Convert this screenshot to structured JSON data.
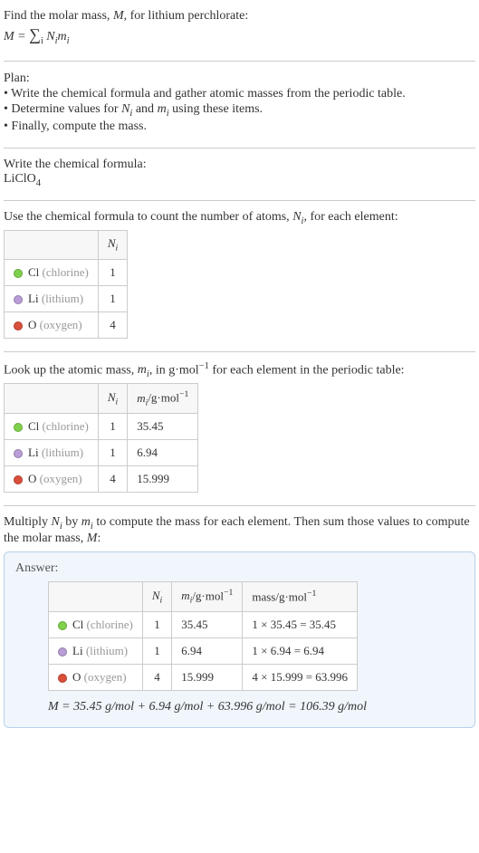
{
  "intro": {
    "line1_pre": "Find the molar mass, ",
    "line1_M": "M",
    "line1_post": ", for lithium perchlorate:",
    "eq_lhs": "M = ",
    "eq_rhs": "N_i m_i"
  },
  "plan": {
    "title": "Plan:",
    "items": [
      "• Write the chemical formula and gather atomic masses from the periodic table.",
      "• Determine values for N_i and m_i using these items.",
      "• Finally, compute the mass."
    ]
  },
  "chemFormula": {
    "intro": "Write the chemical formula:",
    "formula_main": "LiClO",
    "formula_sub": "4"
  },
  "countAtoms": {
    "intro_pre": "Use the chemical formula to count the number of atoms, ",
    "intro_var": "N_i",
    "intro_post": ", for each element:",
    "header_N": "N_i",
    "rows": [
      {
        "dot": "dot-cl",
        "sym": "Cl",
        "name": "(chlorine)",
        "n": "1"
      },
      {
        "dot": "dot-li",
        "sym": "Li",
        "name": "(lithium)",
        "n": "1"
      },
      {
        "dot": "dot-o",
        "sym": "O",
        "name": "(oxygen)",
        "n": "4"
      }
    ]
  },
  "atomicMass": {
    "intro_pre": "Look up the atomic mass, ",
    "intro_var": "m_i",
    "intro_mid": ", in g·mol",
    "intro_sup": "−1",
    "intro_post": " for each element in the periodic table:",
    "header_N": "N_i",
    "header_m": "m_i/g·mol^−1",
    "rows": [
      {
        "dot": "dot-cl",
        "sym": "Cl",
        "name": "(chlorine)",
        "n": "1",
        "m": "35.45"
      },
      {
        "dot": "dot-li",
        "sym": "Li",
        "name": "(lithium)",
        "n": "1",
        "m": "6.94"
      },
      {
        "dot": "dot-o",
        "sym": "O",
        "name": "(oxygen)",
        "n": "4",
        "m": "15.999"
      }
    ]
  },
  "multiply": {
    "text": "Multiply N_i by m_i to compute the mass for each element. Then sum those values to compute the molar mass, M:"
  },
  "answer": {
    "title": "Answer:",
    "header_N": "N_i",
    "header_m": "m_i/g·mol^−1",
    "header_mass": "mass/g·mol^−1",
    "rows": [
      {
        "dot": "dot-cl",
        "sym": "Cl",
        "name": "(chlorine)",
        "n": "1",
        "m": "35.45",
        "calc": "1 × 35.45 = 35.45"
      },
      {
        "dot": "dot-li",
        "sym": "Li",
        "name": "(lithium)",
        "n": "1",
        "m": "6.94",
        "calc": "1 × 6.94 = 6.94"
      },
      {
        "dot": "dot-o",
        "sym": "O",
        "name": "(oxygen)",
        "n": "4",
        "m": "15.999",
        "calc": "4 × 15.999 = 63.996"
      }
    ],
    "final": "M = 35.45 g/mol + 6.94 g/mol + 63.996 g/mol = 106.39 g/mol"
  }
}
